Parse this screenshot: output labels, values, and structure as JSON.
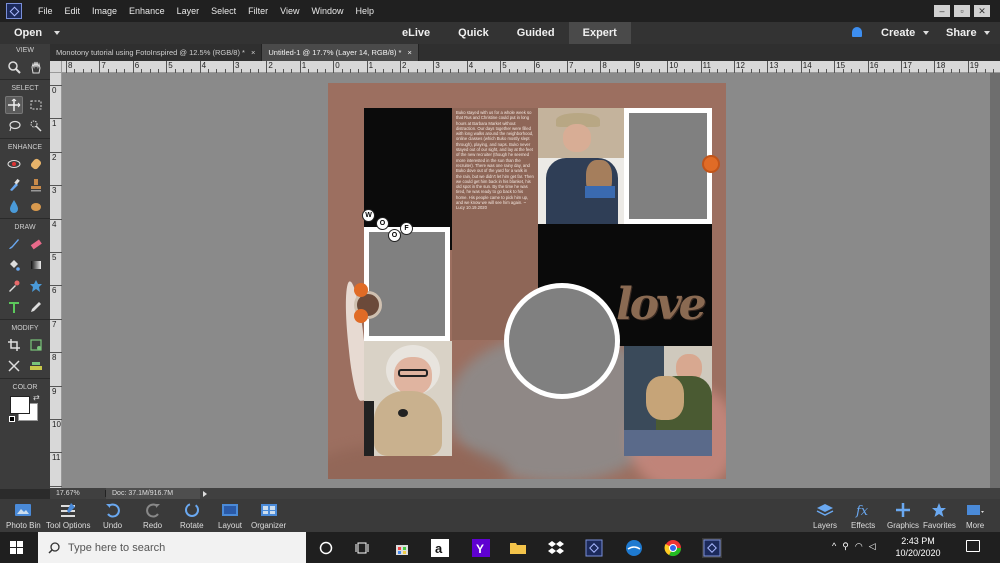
{
  "menubar": {
    "items": [
      "File",
      "Edit",
      "Image",
      "Enhance",
      "Layer",
      "Select",
      "Filter",
      "View",
      "Window",
      "Help"
    ]
  },
  "modebar": {
    "open_label": "Open",
    "modes": [
      "eLive",
      "Quick",
      "Guided",
      "Expert"
    ],
    "active_mode": "Expert",
    "create_label": "Create",
    "share_label": "Share"
  },
  "toolpanel": {
    "sections": [
      "VIEW",
      "SELECT",
      "ENHANCE",
      "DRAW",
      "MODIFY",
      "COLOR"
    ]
  },
  "doc_tabs": [
    {
      "label": "Monotony tutorial using FotoInspired @ 12.5% (RGB/8) *",
      "active": false
    },
    {
      "label": "Untitled-1 @ 17.7% (Layer 14, RGB/8) *",
      "active": true
    }
  ],
  "ruler": {
    "h_labels": [
      "8",
      "7",
      "6",
      "5",
      "4",
      "3",
      "2",
      "1",
      "0",
      "1",
      "2",
      "3",
      "4",
      "5",
      "6",
      "7",
      "8",
      "9",
      "10",
      "11",
      "12",
      "13",
      "14",
      "15",
      "16",
      "17",
      "18",
      "19"
    ],
    "v_labels": [
      "0",
      "1",
      "2",
      "3",
      "4",
      "5",
      "6",
      "7",
      "8",
      "9",
      "10",
      "11",
      "12"
    ]
  },
  "document": {
    "journal_text": "Buko stayed with us for a whole week so that Rus and Christine could put in long hours at Barbara Market without distraction. Our days together were filled with long walks around the neighborhood, online classes (which Buko mostly slept through), playing, and naps. Buko never stayed out of our sight, and lay at the feet of the new recruiter (though he seemed more interested in the sun than the recruiter). There was one rainy day, and Buko dove out of the yard for a walk in the rain, but we didn't let him get far. Then we could get him back in his blanket, his old spot in the sun. By the time he was tired, he was ready to go back to his home. His people came to pick him up, and we know we will see him again. ~ Lucy 10.19.2020",
    "word_art": "love",
    "woof_letters": [
      "W",
      "O",
      "O",
      "F"
    ]
  },
  "statusbar": {
    "zoom": "17.67%",
    "doc_info": "Doc: 37.1M/916.7M"
  },
  "bottombar": {
    "left_buttons": [
      "Photo Bin",
      "Tool Options",
      "Undo",
      "Redo",
      "Rotate",
      "Layout",
      "Organizer"
    ],
    "right_buttons": [
      "Layers",
      "Effects",
      "Graphics",
      "Favorites",
      "More"
    ]
  },
  "taskbar": {
    "search_placeholder": "Type here to search",
    "time": "2:43 PM",
    "date": "10/20/2020"
  },
  "colors": {
    "accent_blue": "#3d8ef0",
    "doc_background": "#9c6f60",
    "frame_white": "#ffffff",
    "placeholder_gray": "#808080"
  }
}
